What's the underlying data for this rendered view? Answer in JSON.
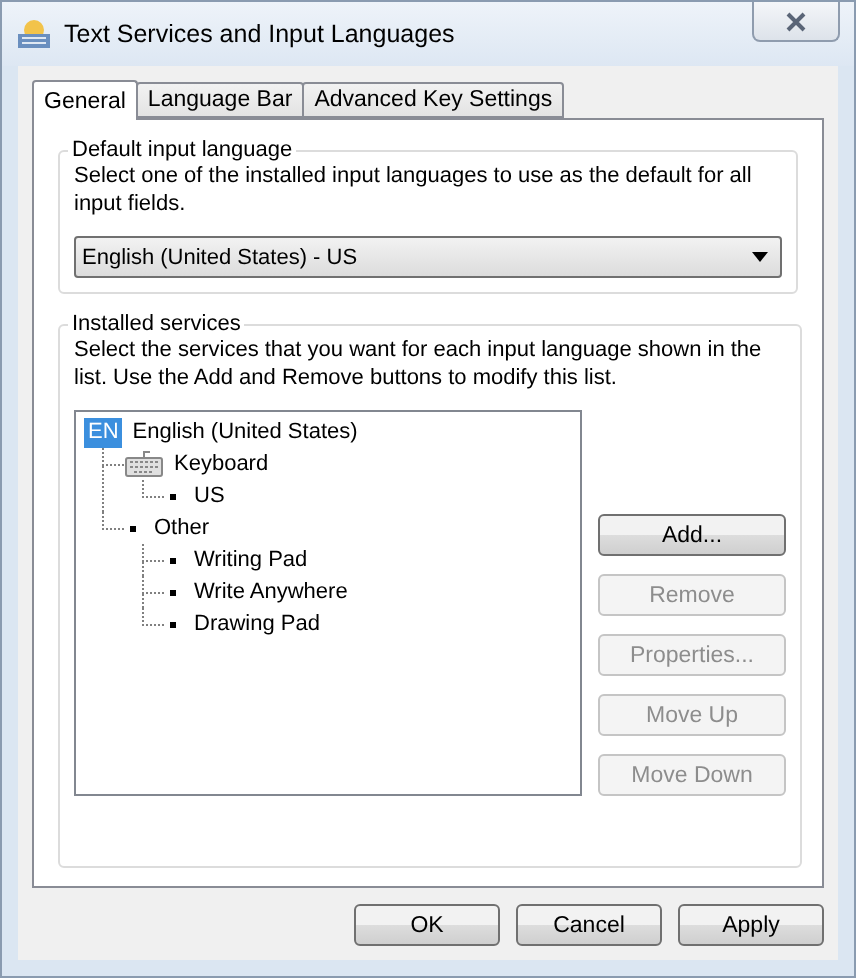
{
  "window": {
    "title": "Text Services and Input Languages"
  },
  "tabs": [
    {
      "label": "General",
      "selected": true
    },
    {
      "label": "Language Bar",
      "selected": false
    },
    {
      "label": "Advanced Key Settings",
      "selected": false
    }
  ],
  "default_input_language": {
    "legend": "Default input language",
    "description": "Select one of the installed input languages to use as the default for all input fields.",
    "value": "English (United States) - US"
  },
  "installed_services": {
    "legend": "Installed services",
    "description": "Select the services that you want for each input language shown in the list. Use the Add and Remove buttons to modify this list.",
    "tree": [
      {
        "kind": "language",
        "badge": "EN",
        "label": "English (United States)",
        "children": [
          {
            "kind": "keyboard",
            "label": "Keyboard",
            "children": [
              {
                "kind": "bullet",
                "label": "US"
              }
            ]
          },
          {
            "kind": "bullet",
            "label": "Other",
            "children": [
              {
                "kind": "bullet",
                "label": "Writing Pad"
              },
              {
                "kind": "bullet",
                "label": "Write Anywhere"
              },
              {
                "kind": "bullet",
                "label": "Drawing Pad"
              }
            ]
          }
        ]
      }
    ],
    "buttons": [
      {
        "label": "Add...",
        "disabled": false
      },
      {
        "label": "Remove",
        "disabled": true
      },
      {
        "label": "Properties...",
        "disabled": true
      },
      {
        "label": "Move Up",
        "disabled": true
      },
      {
        "label": "Move Down",
        "disabled": true
      }
    ]
  },
  "dialog_buttons": [
    "OK",
    "Cancel",
    "Apply"
  ]
}
